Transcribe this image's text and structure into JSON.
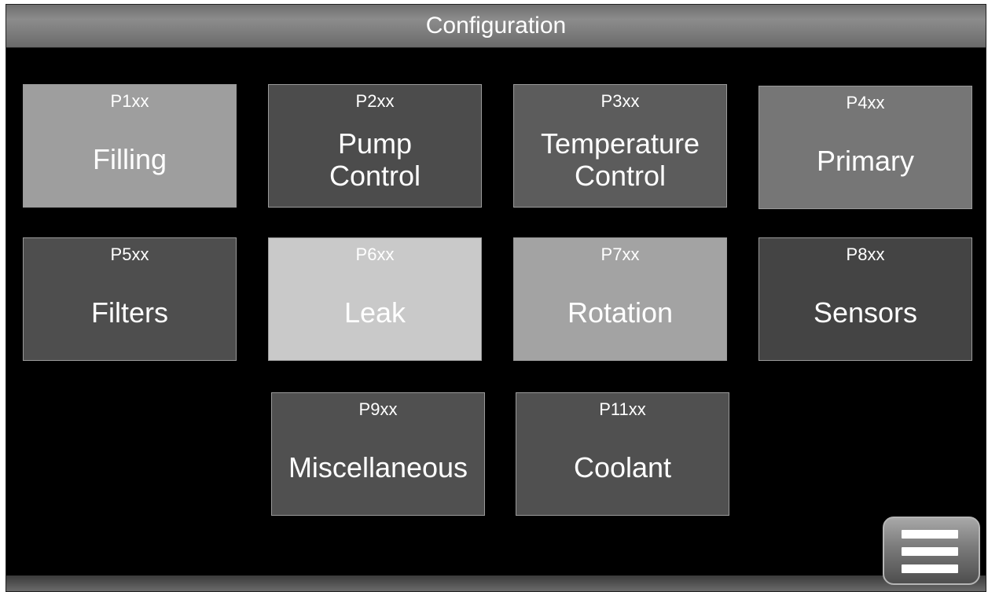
{
  "header": {
    "title": "Configuration"
  },
  "tiles": [
    {
      "code": "P1xx",
      "label": "Filling",
      "color": "#9e9e9e"
    },
    {
      "code": "P2xx",
      "label": "Pump\nControl",
      "color": "#4c4c4c"
    },
    {
      "code": "P3xx",
      "label": "Temperature\nControl",
      "color": "#5c5c5c"
    },
    {
      "code": "P4xx",
      "label": "Primary",
      "color": "#767676"
    },
    {
      "code": "P5xx",
      "label": "Filters",
      "color": "#4e4e4e"
    },
    {
      "code": "P6xx",
      "label": "Leak",
      "color": "#c9c9c9"
    },
    {
      "code": "P7xx",
      "label": "Rotation",
      "color": "#a3a3a3"
    },
    {
      "code": "P8xx",
      "label": "Sensors",
      "color": "#444444"
    },
    {
      "code": "P9xx",
      "label": "Miscellaneous",
      "color": "#505050"
    },
    {
      "code": "P11xx",
      "label": "Coolant",
      "color": "#505050"
    }
  ],
  "menu_button": {
    "icon": "hamburger-menu-icon"
  }
}
